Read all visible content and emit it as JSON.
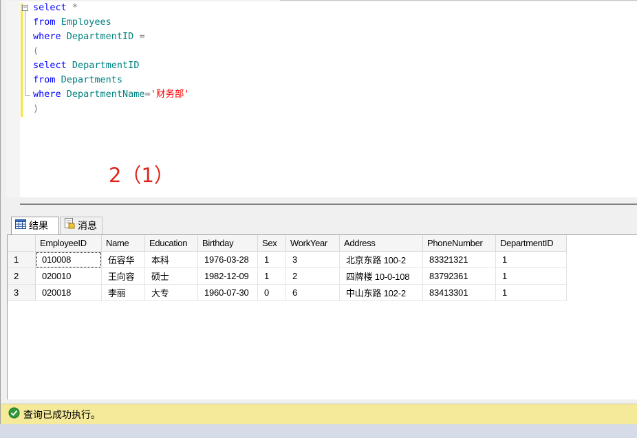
{
  "editor": {
    "lines": [
      {
        "kw1": "select",
        "rest_op": " *"
      },
      {
        "kw1": "from",
        "id1": " Employees"
      },
      {
        "kw1": "where",
        "id1": " DepartmentID",
        "op1": " ="
      },
      {
        "op1": "("
      },
      {
        "kw1": "select",
        "id1": " DepartmentID"
      },
      {
        "kw1": "from",
        "id1": " Departments"
      },
      {
        "kw1": "where",
        "id1": " DepartmentName",
        "op1": "=",
        "str1": "'财务部'"
      },
      {
        "op1": ")"
      }
    ],
    "fold_symbol": "−",
    "annotation": "2（1）"
  },
  "tabs": [
    {
      "label": "结果",
      "icon": "grid-icon"
    },
    {
      "label": "消息",
      "icon": "message-icon"
    }
  ],
  "grid": {
    "columns": [
      "EmployeeID",
      "Name",
      "Education",
      "Birthday",
      "Sex",
      "WorkYear",
      "Address",
      "PhoneNumber",
      "DepartmentID"
    ],
    "rows": [
      {
        "num": "1",
        "cells": [
          "010008",
          "伍容华",
          "本科",
          "1976-03-28",
          "1",
          "3",
          "北京东路 100-2",
          "83321321",
          "1"
        ]
      },
      {
        "num": "2",
        "cells": [
          "020010",
          "王向容",
          "硕士",
          "1982-12-09",
          "1",
          "2",
          "四牌楼 10-0-108",
          "83792361",
          "1"
        ]
      },
      {
        "num": "3",
        "cells": [
          "020018",
          "李丽",
          "大专",
          "1960-07-30",
          "0",
          "6",
          "中山东路 102-2",
          "83413301",
          "1"
        ]
      }
    ]
  },
  "status": {
    "text": "查询已成功执行。",
    "icon": "success-check-icon",
    "color": "#f5e99a"
  }
}
